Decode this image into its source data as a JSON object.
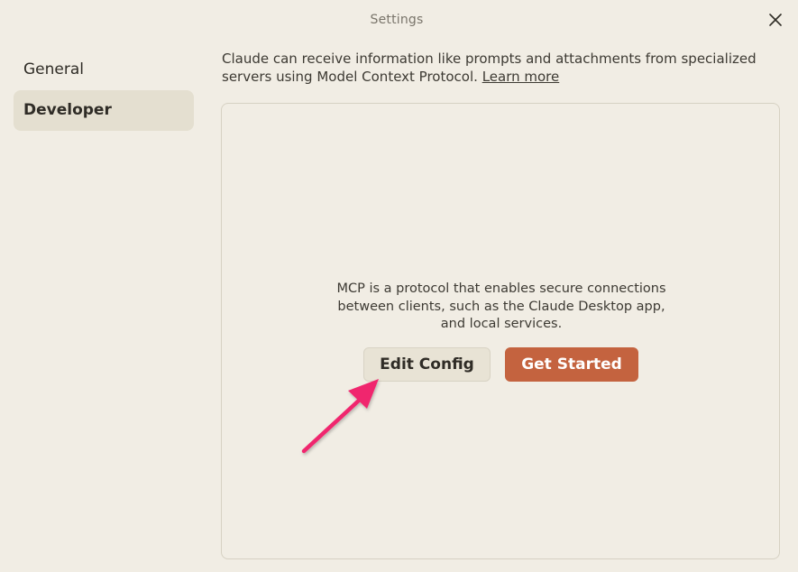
{
  "window": {
    "title": "Settings",
    "close_icon": "close-icon"
  },
  "sidebar": {
    "items": [
      {
        "label": "General",
        "active": false
      },
      {
        "label": "Developer",
        "active": true
      }
    ]
  },
  "developer": {
    "description": "Claude can receive information like prompts and attachments from specialized servers using Model Context Protocol.",
    "learn_more_label": "Learn more",
    "panel": {
      "mcp_text": "MCP is a protocol that enables secure connections between clients, such as the Claude Desktop app, and local services.",
      "edit_config_label": "Edit Config",
      "get_started_label": "Get Started"
    }
  },
  "annotation": {
    "arrow_icon": "pointer-arrow-icon",
    "arrow_color": "#f0286e"
  },
  "colors": {
    "background": "#f1ede4",
    "sidebar_active": "#e4dfd0",
    "accent": "#c4633f"
  }
}
